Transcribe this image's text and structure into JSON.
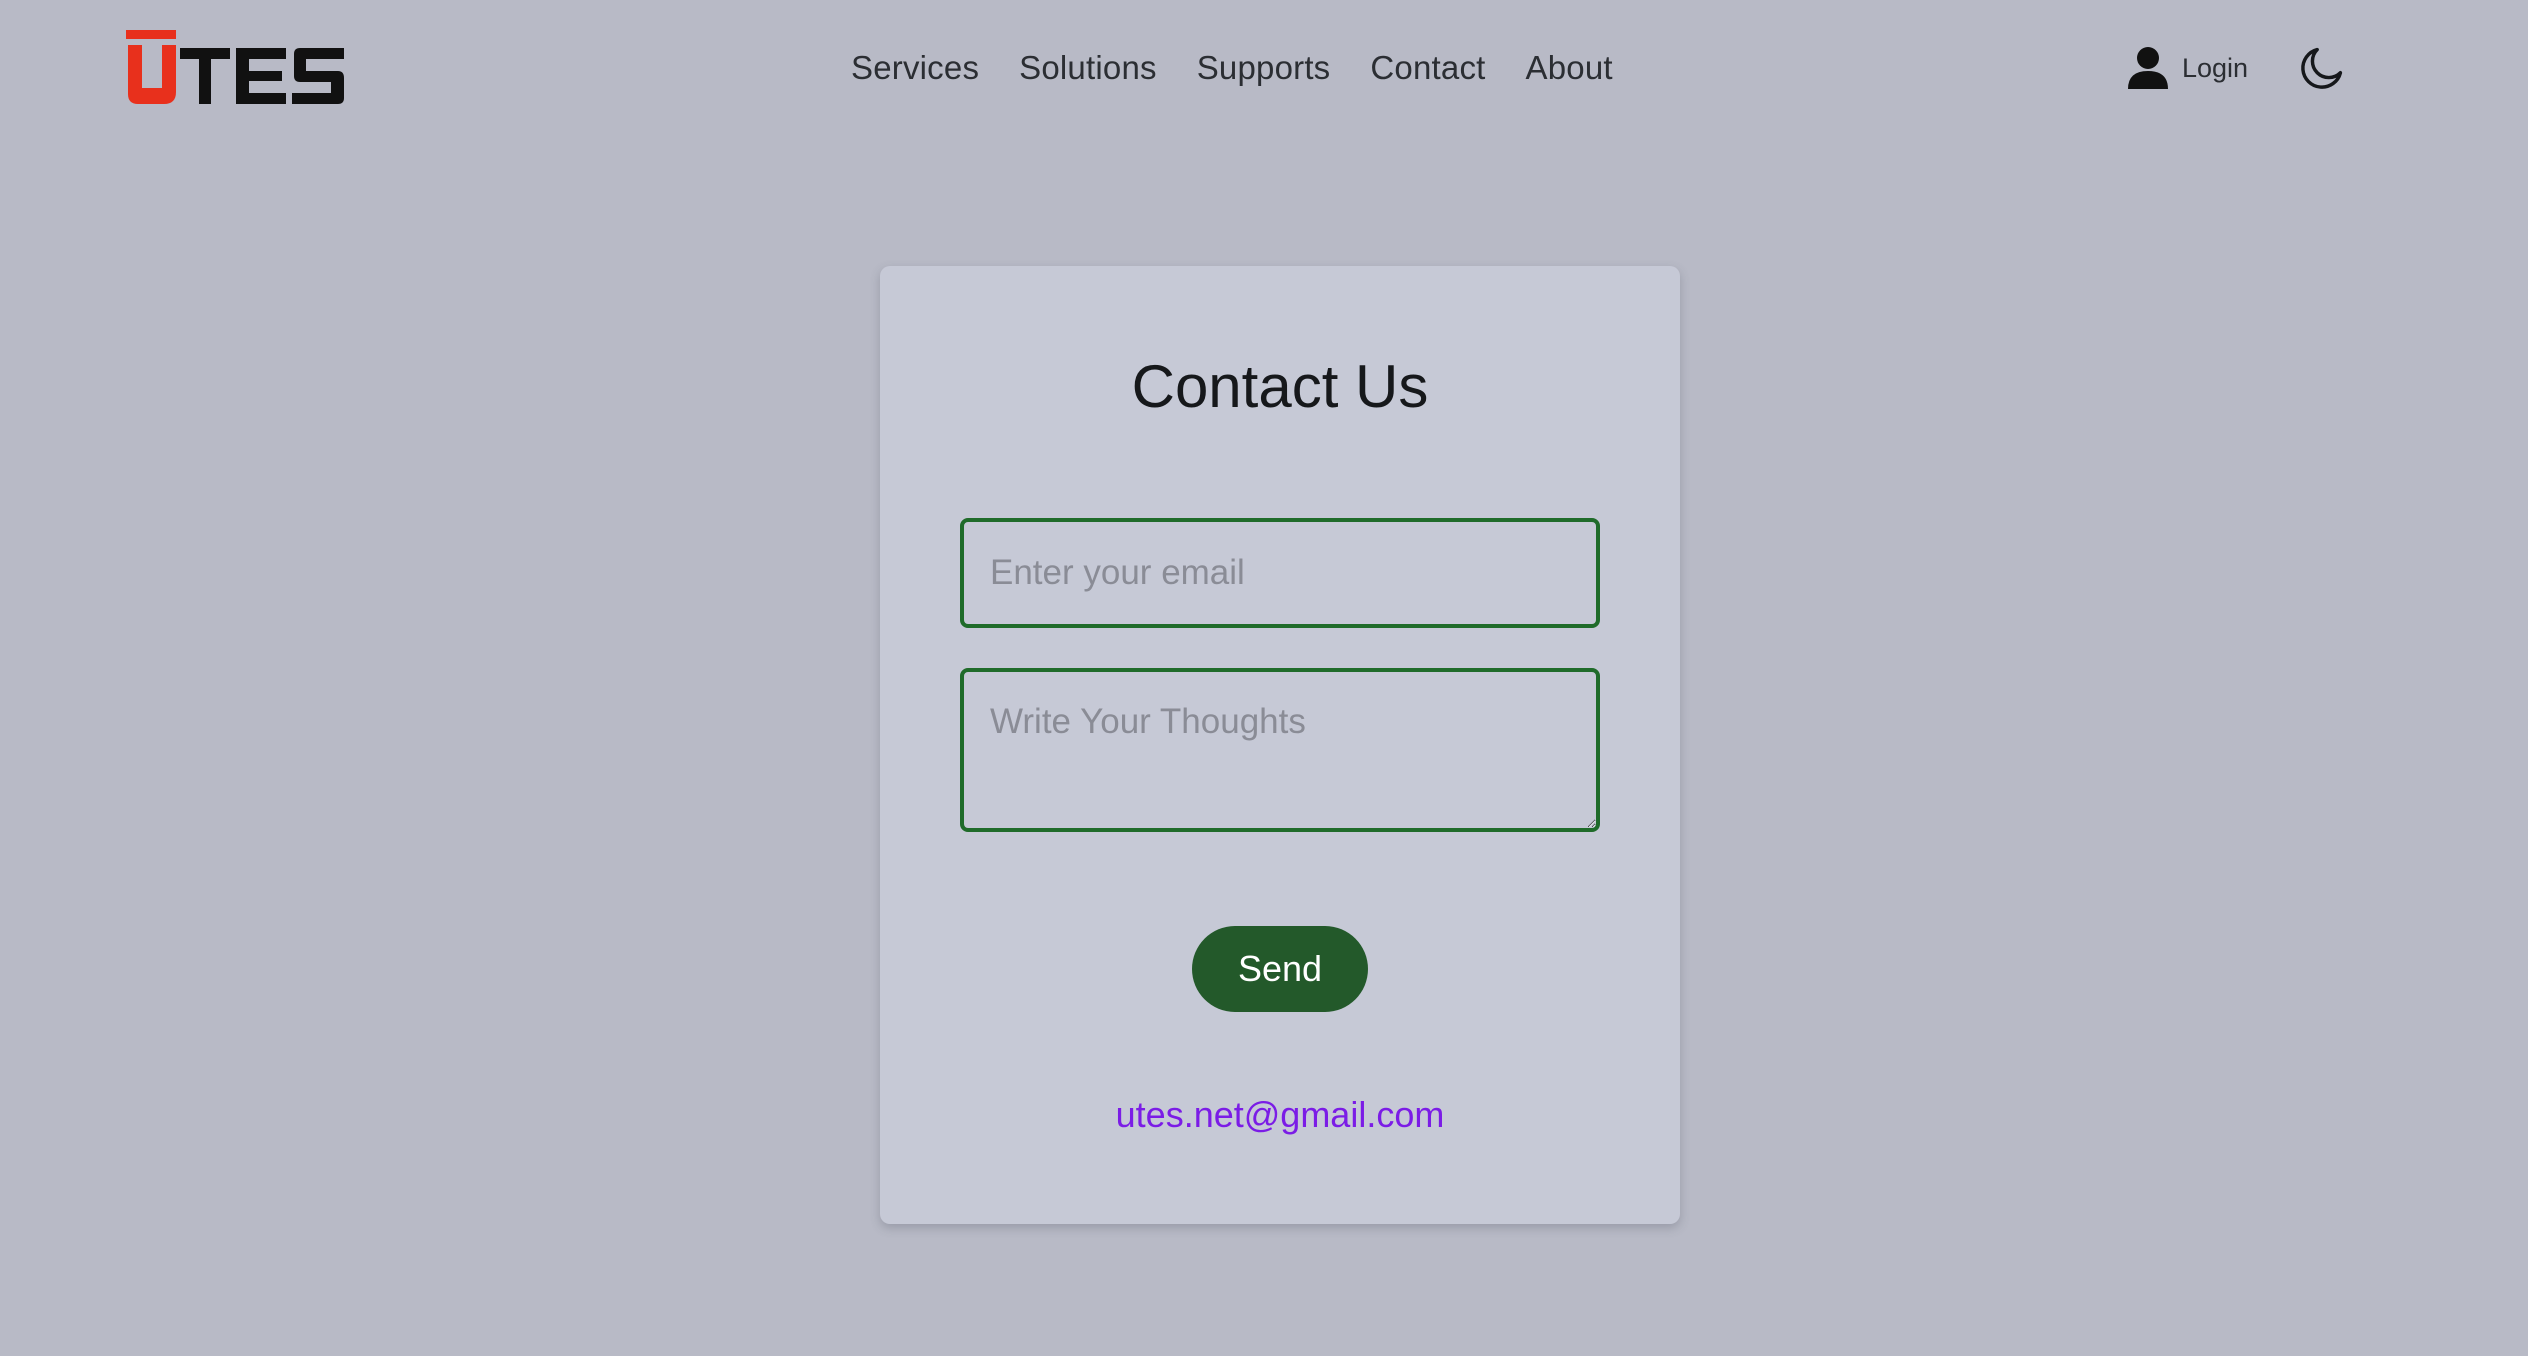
{
  "header": {
    "logo_text": "UTES",
    "nav": [
      {
        "label": "Services"
      },
      {
        "label": "Solutions"
      },
      {
        "label": "Supports"
      },
      {
        "label": "Contact"
      },
      {
        "label": "About"
      }
    ],
    "login_label": "Login",
    "theme_icon": "moon-icon",
    "user_icon": "user-icon"
  },
  "contact": {
    "title": "Contact Us",
    "email_placeholder": "Enter your email",
    "email_value": "",
    "message_placeholder": "Write Your Thoughts",
    "message_value": "",
    "send_label": "Send",
    "contact_email": "utes.net@gmail.com"
  },
  "colors": {
    "background": "#b8bac6",
    "card": "#c6c9d6",
    "field_border": "#1f6b2a",
    "send_button": "#23592a",
    "email_link": "#7b1ce6",
    "logo_accent": "#e8301c",
    "logo_text": "#111111"
  }
}
